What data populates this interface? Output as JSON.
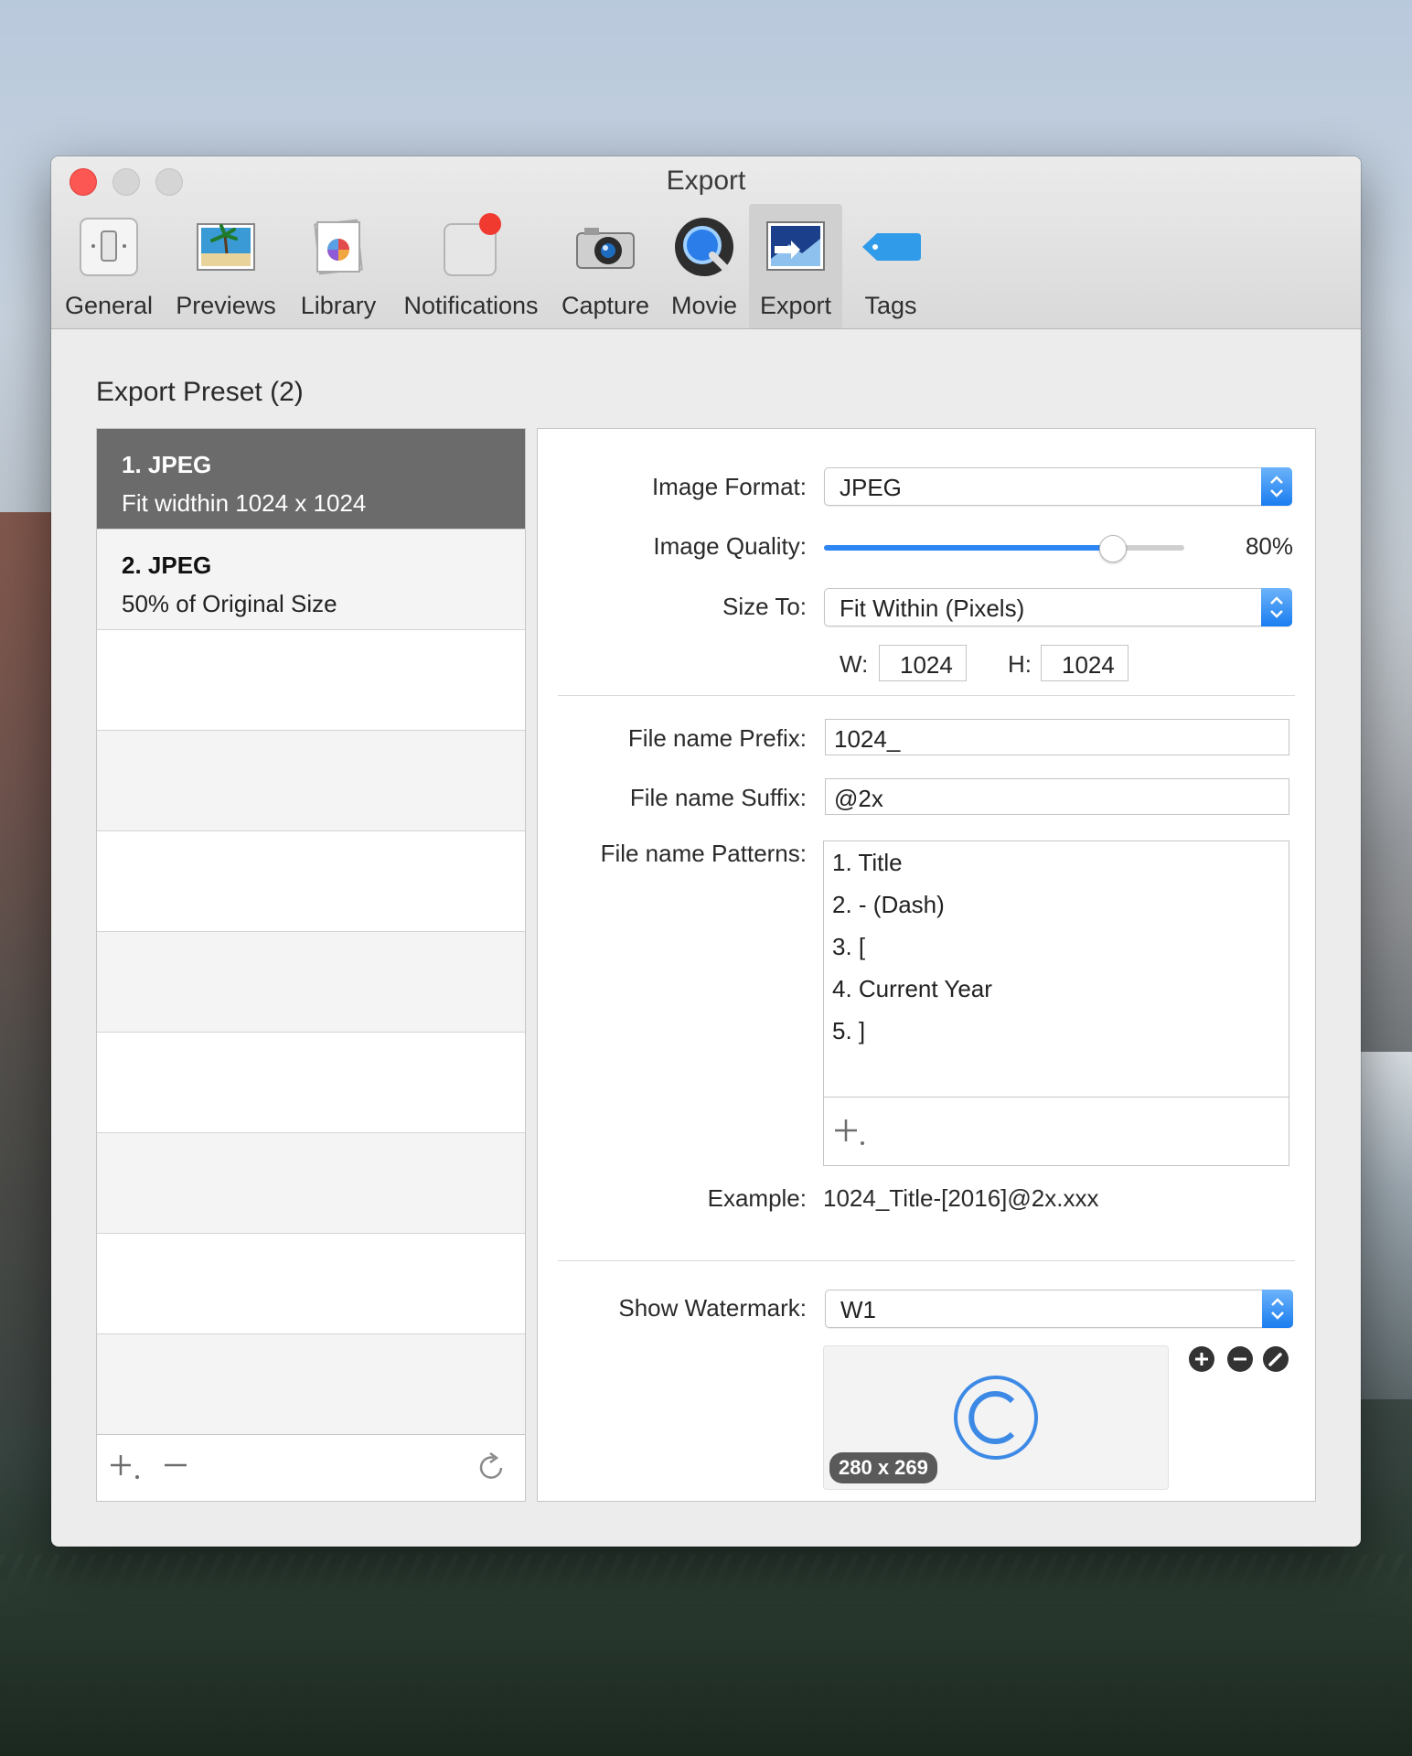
{
  "window": {
    "title": "Export"
  },
  "toolbar": [
    {
      "label": "General",
      "icon": "general-icon"
    },
    {
      "label": "Previews",
      "icon": "previews-icon"
    },
    {
      "label": "Library",
      "icon": "library-icon"
    },
    {
      "label": "Notifications",
      "icon": "notifications-icon"
    },
    {
      "label": "Capture",
      "icon": "camera-icon"
    },
    {
      "label": "Movie",
      "icon": "quicktime-icon"
    },
    {
      "label": "Export",
      "icon": "export-icon",
      "active": true
    },
    {
      "label": "Tags",
      "icon": "tag-icon"
    }
  ],
  "presets": {
    "title": "Export Preset (2)",
    "items": [
      {
        "name": "1. JPEG",
        "desc": "Fit widthin 1024 x 1024",
        "selected": true
      },
      {
        "name": "2. JPEG",
        "desc": "50% of Original Size",
        "selected": false
      }
    ]
  },
  "settings": {
    "image_format_label": "Image Format:",
    "image_format_value": "JPEG",
    "image_quality_label": "Image Quality:",
    "image_quality_value": "80%",
    "image_quality_fraction": 0.8,
    "size_to_label": "Size To:",
    "size_to_value": "Fit Within (Pixels)",
    "w_label": "W:",
    "w_value": "1024",
    "h_label": "H:",
    "h_value": "1024",
    "prefix_label": "File name Prefix:",
    "prefix_value": "1024_",
    "suffix_label": "File name Suffix:",
    "suffix_value": "@2x",
    "patterns_label": "File name Patterns:",
    "patterns": [
      "1. Title",
      "2. - (Dash)",
      "3. [",
      "4. Current Year",
      "5. ]"
    ],
    "example_label": "Example:",
    "example_value": "1024_Title-[2016]@2x.xxx",
    "watermark_label": "Show Watermark:",
    "watermark_value": "W1",
    "watermark_size": "280 x 269"
  },
  "colors": {
    "close_button": "#fc5753",
    "accent": "#2e86f5",
    "selection": "#6b6b6b"
  }
}
